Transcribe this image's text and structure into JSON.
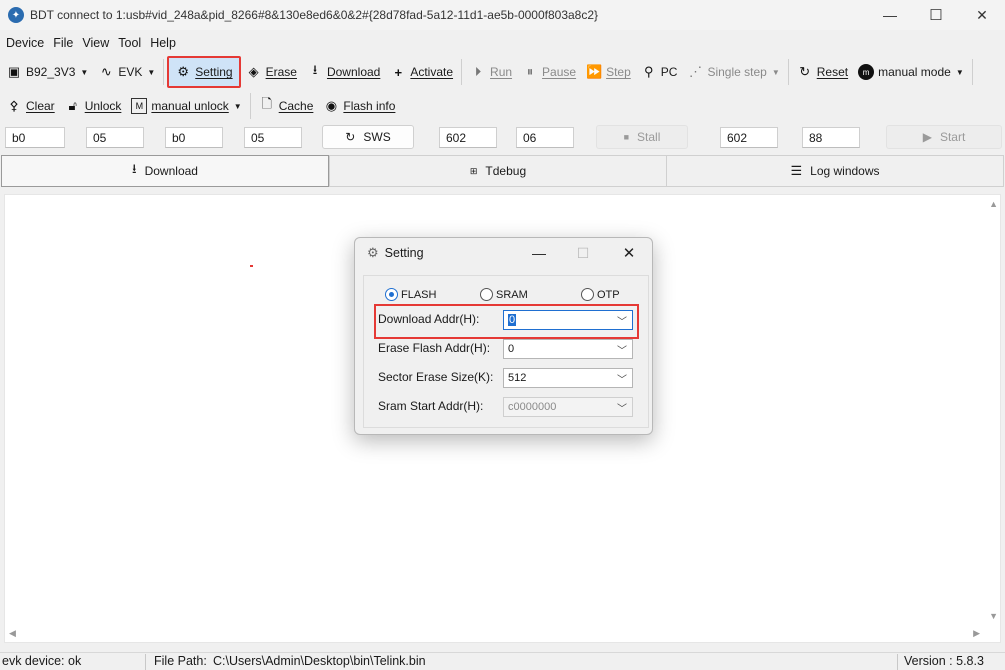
{
  "window": {
    "title": "BDT connect to 1:usb#vid_248a&pid_8266#8&130e8ed6&0&2#{28d78fad-5a12-11d1-ae5b-0000f803a8c2}",
    "minimize": "—",
    "maximize": "☐",
    "close": "✕"
  },
  "menu": [
    "Device",
    "File",
    "View",
    "Tool",
    "Help"
  ],
  "toolbar1": {
    "chip": "B92_3V3",
    "board": "EVK",
    "setting": "Setting",
    "erase": "Erase",
    "download": "Download",
    "activate": "Activate",
    "run": "Run",
    "pause": "Pause",
    "step": "Step",
    "pc": "PC",
    "single_step": "Single step",
    "reset": "Reset",
    "manual_mode": "manual mode"
  },
  "toolbar2": {
    "clear": "Clear",
    "unlock": "Unlock",
    "manual_unlock": "manual unlock",
    "cache": "Cache",
    "flash_info": "Flash info"
  },
  "inputs_row": {
    "f1": "b0",
    "f2": "05",
    "f3": "b0",
    "f4": "05",
    "sws": "SWS",
    "f5": "602",
    "f6": "06",
    "stall": "Stall",
    "f7": "602",
    "f8": "88",
    "start": "Start"
  },
  "tabs": {
    "download": "Download",
    "tdebug": "Tdebug",
    "log": "Log windows"
  },
  "status": {
    "device": "evk device: ok",
    "file_path_label": "File Path:",
    "file_path": "C:\\Users\\Admin\\Desktop\\bin\\Telink.bin",
    "version": "Version : 5.8.3"
  },
  "dialog": {
    "title": "Setting",
    "radios": {
      "flash": "FLASH",
      "sram": "SRAM",
      "otp": "OTP",
      "selected": "FLASH"
    },
    "download_addr_label": "Download  Addr(H):",
    "download_addr_value": "0",
    "erase_flash_addr_label": "Erase Flash Addr(H):",
    "erase_flash_addr_value": "0",
    "sector_erase_size_label": "Sector Erase Size(K):",
    "sector_erase_size_value": "512",
    "sram_start_addr_label": "Sram Start Addr(H):",
    "sram_start_addr_value": "c0000000"
  },
  "colors": {
    "highlight_red": "#e53935",
    "accent_blue": "#1f6fd1",
    "setting_bg": "#cfe3f7"
  }
}
